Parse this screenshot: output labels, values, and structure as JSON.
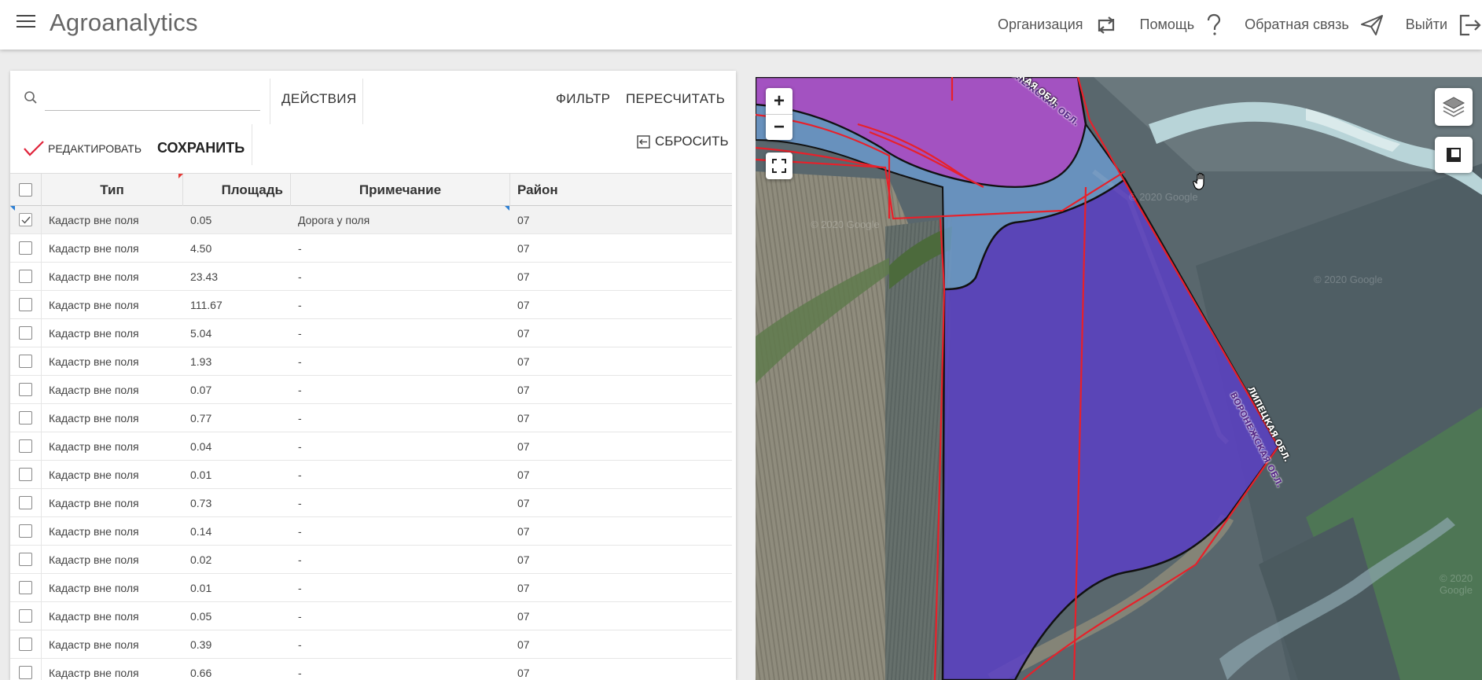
{
  "app": {
    "title": "Agroanalytics"
  },
  "nav": {
    "organization": "Организация",
    "help": "Помощь",
    "feedback": "Обратная связь",
    "logout": "Выйти"
  },
  "toolbar": {
    "search_placeholder": "",
    "actions": "ДЕЙСТВИЯ",
    "filter": "ФИЛЬТР",
    "recalculate": "ПЕРЕСЧИТАТЬ",
    "edit": "РЕДАКТИРОВАТЬ",
    "save": "СОХРАНИТЬ",
    "reset": "СБРОСИТЬ"
  },
  "table": {
    "columns": [
      "Тип",
      "Площадь",
      "Примечание",
      "Район"
    ],
    "rows": [
      {
        "type": "Кадастр вне поля",
        "area": "0.05",
        "note": "Дорога у поля",
        "district": "07",
        "checked": true
      },
      {
        "type": "Кадастр вне поля",
        "area": "4.50",
        "note": "-",
        "district": "07",
        "checked": false
      },
      {
        "type": "Кадастр вне поля",
        "area": "23.43",
        "note": "-",
        "district": "07",
        "checked": false
      },
      {
        "type": "Кадастр вне поля",
        "area": "111.67",
        "note": "-",
        "district": "07",
        "checked": false
      },
      {
        "type": "Кадастр вне поля",
        "area": "5.04",
        "note": "-",
        "district": "07",
        "checked": false
      },
      {
        "type": "Кадастр вне поля",
        "area": "1.93",
        "note": "-",
        "district": "07",
        "checked": false
      },
      {
        "type": "Кадастр вне поля",
        "area": "0.07",
        "note": "-",
        "district": "07",
        "checked": false
      },
      {
        "type": "Кадастр вне поля",
        "area": "0.77",
        "note": "-",
        "district": "07",
        "checked": false
      },
      {
        "type": "Кадастр вне поля",
        "area": "0.04",
        "note": "-",
        "district": "07",
        "checked": false
      },
      {
        "type": "Кадастр вне поля",
        "area": "0.01",
        "note": "-",
        "district": "07",
        "checked": false
      },
      {
        "type": "Кадастр вне поля",
        "area": "0.73",
        "note": "-",
        "district": "07",
        "checked": false
      },
      {
        "type": "Кадастр вне поля",
        "area": "0.14",
        "note": "-",
        "district": "07",
        "checked": false
      },
      {
        "type": "Кадастр вне поля",
        "area": "0.02",
        "note": "-",
        "district": "07",
        "checked": false
      },
      {
        "type": "Кадастр вне поля",
        "area": "0.01",
        "note": "-",
        "district": "07",
        "checked": false
      },
      {
        "type": "Кадастр вне поля",
        "area": "0.05",
        "note": "-",
        "district": "07",
        "checked": false
      },
      {
        "type": "Кадастр вне поля",
        "area": "0.39",
        "note": "-",
        "district": "07",
        "checked": false
      },
      {
        "type": "Кадастр вне поля",
        "area": "0.66",
        "note": "-",
        "district": "07",
        "checked": false
      }
    ]
  },
  "map": {
    "zoom_in": "+",
    "zoom_out": "−",
    "labels": {
      "region_top": "ВОРОНЕЖСКАЯ ОБЛ.",
      "region_top2": "ЛИПЕЦКАЯ ОБЛ.",
      "region_right": "ВОРОНЕЖСКАЯ ОБЛ.",
      "region_right2": "ЛИПЕЦКАЯ ОБЛ."
    },
    "copyright": [
      "© 2020 Google",
      "© 2020 Google",
      "© 2020 Google",
      "© 2020 Google"
    ],
    "colors": {
      "magenta_parcel": "#b04fd0",
      "purple_parcel": "#5b3fc4",
      "blue_parcel": "#6e9fd8",
      "boundary": "#e8202a"
    }
  }
}
